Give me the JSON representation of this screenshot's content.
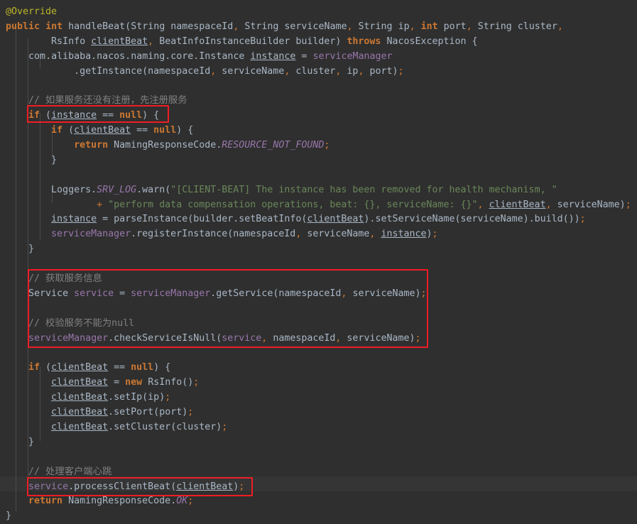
{
  "editor": {
    "language": "java",
    "background_color": "#2f2f2f",
    "foreground_color": "#a9b7c6",
    "current_line_color": "#353535",
    "search_highlight_color": "#32593d",
    "annotation_color": "#ee1d24",
    "font_size_px": 13,
    "line_height_px": 21
  },
  "code_lines": [
    "@Override",
    "public int handleBeat(String namespaceId, String serviceName, String ip, int port, String cluster,",
    "        RsInfo clientBeat, BeatInfoInstanceBuilder builder) throws NacosException {",
    "    com.alibaba.nacos.naming.core.Instance instance = serviceManager",
    "            .getInstance(namespaceId, serviceName, cluster, ip, port);",
    "",
    "    // 如果服务还没有注册，先注册服务",
    "    if (instance == null) {",
    "        if (clientBeat == null) {",
    "            return NamingResponseCode.RESOURCE_NOT_FOUND;",
    "        }",
    "",
    "        Loggers.SRV_LOG.warn(\"[CLIENT-BEAT] The instance has been removed for health mechanism, \"",
    "                + \"perform data compensation operations, beat: {}, serviceName: {}\", clientBeat, serviceName);",
    "        instance = parseInstance(builder.setBeatInfo(clientBeat).setServiceName(serviceName).build());",
    "        serviceManager.registerInstance(namespaceId, serviceName, instance);",
    "    }",
    "",
    "    // 获取服务信息",
    "    Service service = serviceManager.getService(namespaceId, serviceName);",
    "",
    "    // 校验服务不能为null",
    "    serviceManager.checkServiceIsNull(service, namespaceId, serviceName);",
    "",
    "    if (clientBeat == null) {",
    "        clientBeat = new RsInfo();",
    "        clientBeat.setIp(ip);",
    "        clientBeat.setPort(port);",
    "        clientBeat.setCluster(cluster);",
    "    }",
    "",
    "    // 处理客户端心跳",
    "    service.processClientBeat(clientBeat);",
    "    return NamingResponseCode.OK;",
    "}"
  ],
  "tokens": {
    "annotation": "@Override",
    "keywords": [
      "public",
      "int",
      "throws",
      "if",
      "return",
      "new"
    ],
    "types": [
      "String",
      "RsInfo",
      "BeatInfoInstanceBuilder",
      "NacosException",
      "Service",
      "Instance"
    ],
    "literals": [
      "null"
    ],
    "method_name": "handleBeat",
    "fields": [
      "serviceManager",
      "service"
    ],
    "static_fields": [
      "SRV_LOG",
      "RESOURCE_NOT_FOUND",
      "OK"
    ],
    "local_vars": [
      "clientBeat",
      "instance"
    ],
    "strings": [
      "\"[CLIENT-BEAT] The instance has been removed for health mechanism, \"",
      "\"perform data compensation operations, beat: {}, serviceName: {}\""
    ]
  },
  "comments": [
    "// 如果服务还没有注册，先注册服务",
    "// 获取服务信息",
    "// 校验服务不能为null",
    "// 处理客户端心跳"
  ],
  "search_highlight": {
    "text": "processClientBeat",
    "line_index": 31
  },
  "annotations": [
    {
      "label": "highlight-box-if-instance-null",
      "note": "if (instance == null) {"
    },
    {
      "label": "highlight-box-get-service",
      "note": "// 获取服务信息 ... checkServiceIsNull"
    },
    {
      "label": "highlight-box-process-client-beat",
      "note": "service.processClientBeat(clientBeat);"
    }
  ]
}
